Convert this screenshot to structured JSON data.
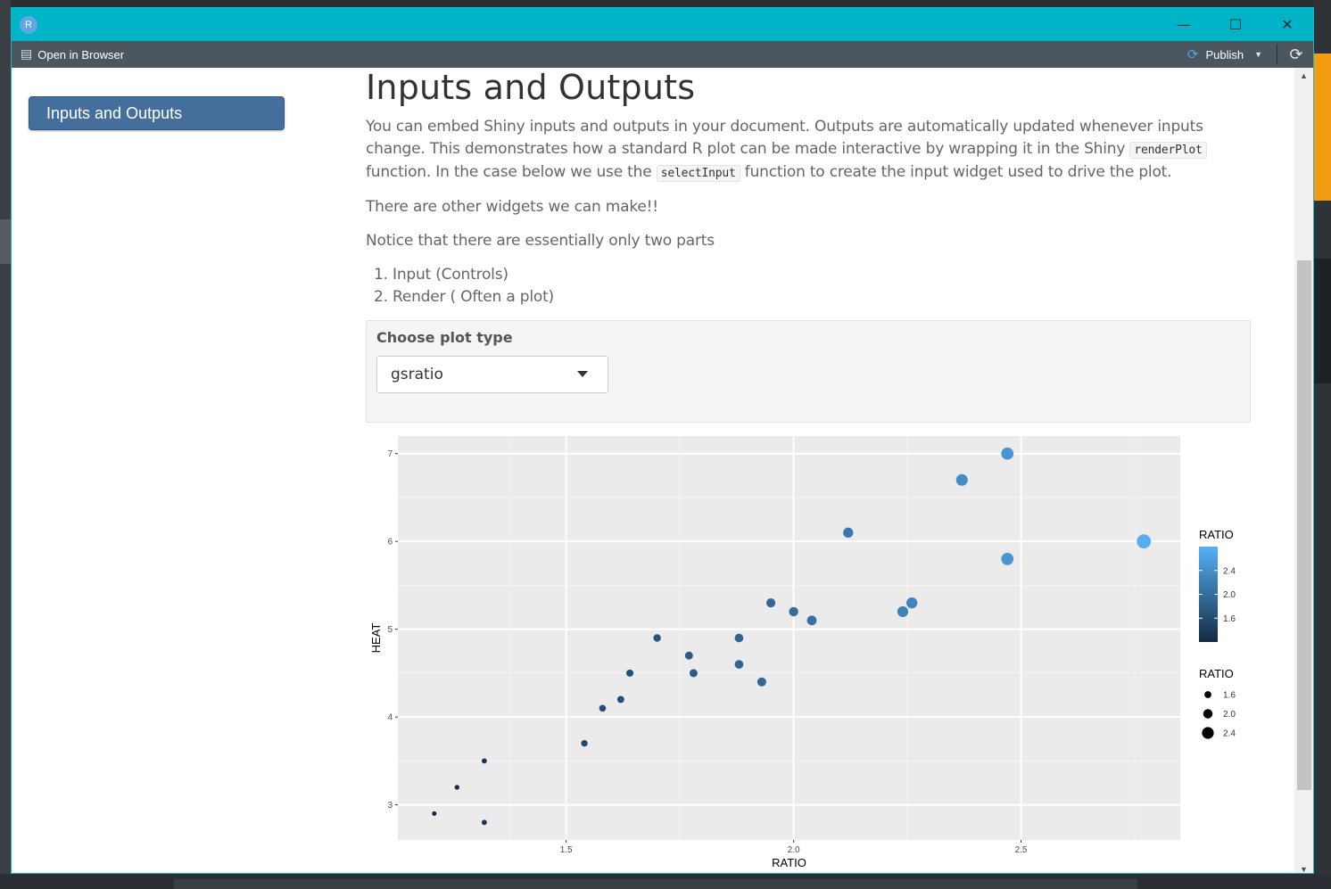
{
  "window": {
    "app_icon": "R",
    "controls": [
      "minimize-icon",
      "maximize-icon",
      "close-icon"
    ]
  },
  "toolbar": {
    "open_in_browser": "Open in Browser",
    "publish": "Publish"
  },
  "toc": {
    "items": [
      "Inputs and Outputs"
    ]
  },
  "doc": {
    "title": "Inputs and Outputs",
    "para1_a": "You can embed Shiny inputs and outputs in your document. Outputs are automatically updated whenever inputs change. This demonstrates how a standard R plot can be made interactive by wrapping it in the Shiny ",
    "code1": "renderPlot",
    "para1_b": " function. In the case below we use the ",
    "code2": "selectInput",
    "para1_c": " function to create the input widget used to drive the plot.",
    "para2": "There are other widgets we can make!!",
    "para3": "Notice that there are essentially only two parts",
    "list": [
      "Input (Controls)",
      "Render ( Often a plot)"
    ]
  },
  "input": {
    "label": "Choose plot type",
    "selected": "gsratio"
  },
  "colors": {
    "accent": "#446e9b",
    "titlebar": "#00b4c8",
    "toolbar": "#4c565e",
    "point_low": "#132b43",
    "point_high": "#56b1f7",
    "panel_bg": "#ebebeb"
  },
  "chart_data": {
    "type": "scatter",
    "xlabel": "RATIO",
    "ylabel": "HEAT",
    "xlim": [
      1.13,
      2.85
    ],
    "ylim": [
      2.6,
      7.2
    ],
    "x_ticks": [
      1.5,
      2.0,
      2.5
    ],
    "x_tick_labels": [
      "1.5",
      "2.0",
      "2.5"
    ],
    "y_ticks": [
      3,
      4,
      5,
      6,
      7
    ],
    "y_tick_labels": [
      "3",
      "4",
      "5",
      "6",
      "7"
    ],
    "grid": true,
    "points": [
      {
        "x": 1.21,
        "y": 2.9
      },
      {
        "x": 1.26,
        "y": 3.2
      },
      {
        "x": 1.32,
        "y": 3.5
      },
      {
        "x": 1.32,
        "y": 2.8
      },
      {
        "x": 1.54,
        "y": 3.7
      },
      {
        "x": 1.58,
        "y": 4.1
      },
      {
        "x": 1.62,
        "y": 4.2
      },
      {
        "x": 1.64,
        "y": 4.5
      },
      {
        "x": 1.7,
        "y": 4.9
      },
      {
        "x": 1.77,
        "y": 4.7
      },
      {
        "x": 1.78,
        "y": 4.5
      },
      {
        "x": 1.88,
        "y": 4.9
      },
      {
        "x": 1.88,
        "y": 4.6
      },
      {
        "x": 1.93,
        "y": 4.4
      },
      {
        "x": 1.95,
        "y": 5.3
      },
      {
        "x": 2.0,
        "y": 5.2
      },
      {
        "x": 2.04,
        "y": 5.1
      },
      {
        "x": 2.12,
        "y": 6.1
      },
      {
        "x": 2.24,
        "y": 5.2
      },
      {
        "x": 2.26,
        "y": 5.3
      },
      {
        "x": 2.37,
        "y": 6.7
      },
      {
        "x": 2.47,
        "y": 7.0
      },
      {
        "x": 2.47,
        "y": 5.8
      },
      {
        "x": 2.77,
        "y": 6.0
      }
    ],
    "color_legend": {
      "title": "RATIO",
      "breaks": [
        "2.4",
        "2.0",
        "1.6"
      ],
      "break_values": [
        2.4,
        2.0,
        1.6
      ]
    },
    "size_legend": {
      "title": "RATIO",
      "breaks": [
        "1.6",
        "2.0",
        "2.4"
      ],
      "break_values": [
        1.6,
        2.0,
        2.4
      ]
    },
    "legend_position": "right"
  }
}
